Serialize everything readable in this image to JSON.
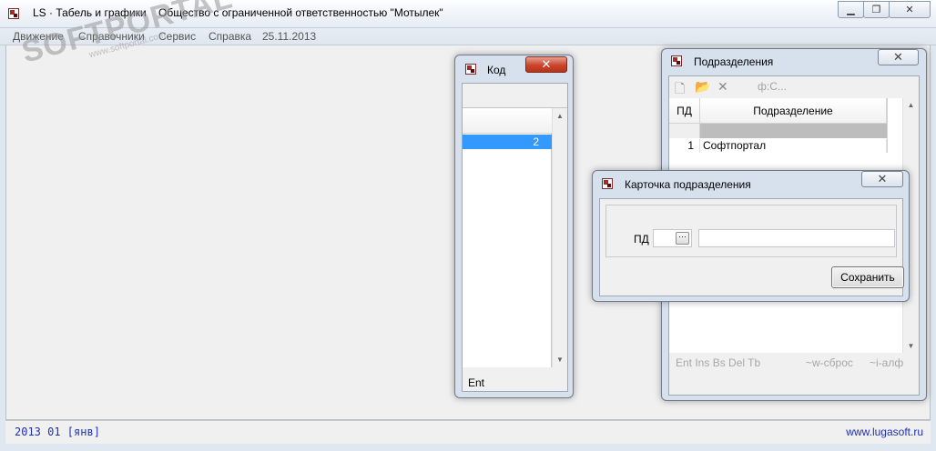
{
  "main_window": {
    "title": "LS · Табель и графики    Общество с ограниченной ответственностью \"Мотылек\"",
    "minimize_icon": "minimize-icon",
    "maximize_icon": "restore-icon",
    "close_icon": "close-icon"
  },
  "menu": {
    "items": [
      {
        "label": "Движение"
      },
      {
        "label": "Справочники"
      },
      {
        "label": "Сервис"
      },
      {
        "label": "Справка"
      }
    ],
    "date": "25.11.2013"
  },
  "watermark": {
    "text": "SOFTPORTAL",
    "sub": "www.softportal.com"
  },
  "status": {
    "period": "2013 01 [янв]",
    "website": "www.lugasoft.ru"
  },
  "kod_window": {
    "title": "Код",
    "close_glyph": "✕",
    "selected_value": "2",
    "footer": "Ent"
  },
  "podrazdeleniya_window": {
    "title": "Подразделения",
    "close_glyph": "✕",
    "toolbar": {
      "new_icon": "new-document-icon",
      "open_icon": "open-folder-icon",
      "delete_icon": "delete-icon",
      "filter_label": "ф:С..."
    },
    "grid": {
      "columns": [
        "ПД",
        "Подразделение"
      ],
      "rows": [
        {
          "pd": "1",
          "name": "Софтпортал"
        }
      ]
    },
    "hints": {
      "keys": "Ent  Ins Bs Del Tb",
      "reset": "~w-сброс",
      "alpha": "~i-алф"
    }
  },
  "card_window": {
    "title": "Карточка подразделения",
    "close_glyph": "✕",
    "pd_label": "ПД",
    "pd_value": "",
    "name_value": "",
    "ellipsis": "···",
    "save_label": "Сохранить"
  }
}
